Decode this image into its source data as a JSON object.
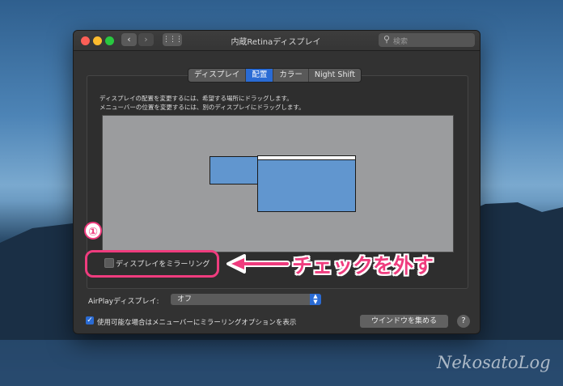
{
  "window": {
    "title": "内蔵Retinaディスプレイ",
    "search_placeholder": "検索"
  },
  "tabs": [
    {
      "label": "ディスプレイ",
      "selected": false
    },
    {
      "label": "配置",
      "selected": true
    },
    {
      "label": "カラー",
      "selected": false
    },
    {
      "label": "Night Shift",
      "selected": false
    }
  ],
  "arrangement": {
    "description_line1": "ディスプレイの配置を変更するには、希望する場所にドラッグします。",
    "description_line2": "メニューバーの位置を変更するには、別のディスプレイにドラッグします。"
  },
  "mirror": {
    "label": "ディスプレイをミラーリング",
    "checked": false
  },
  "airplay": {
    "label": "AirPlayディスプレイ:",
    "value": "オフ"
  },
  "menubar_option": {
    "label": "使用可能な場合はメニューバーにミラーリングオプションを表示",
    "checked": true
  },
  "gather_button": "ウインドウを集める",
  "help_button": "?",
  "annotation": {
    "number": "①",
    "callout": "チェックを外す",
    "color": "#ef3c7e"
  },
  "watermark": "NekosatoLog",
  "colors": {
    "accent": "#2a6bd4",
    "display_fill": "#6196cf",
    "window_bg": "#323232"
  }
}
